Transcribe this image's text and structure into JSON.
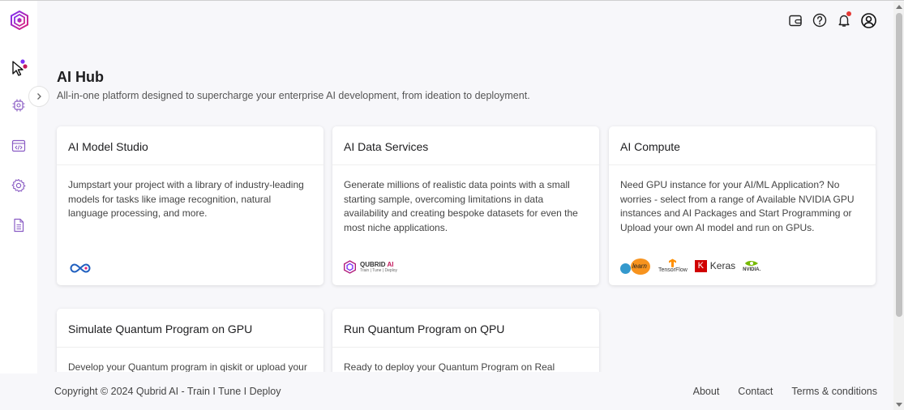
{
  "page": {
    "title": "AI Hub",
    "subtitle": "All-in-one platform designed to supercharge your enterprise AI development, from ideation to deployment."
  },
  "cards": [
    {
      "title": "AI Model Studio",
      "description": "Jumpstart your project with a library of industry-leading models for tasks like image recognition, natural language processing, and more."
    },
    {
      "title": "AI Data Services",
      "description": "Generate millions of realistic data points with a small starting sample, overcoming limitations in data availability and creating bespoke datasets for even the most niche applications.",
      "logo_text": "QUBRID",
      "logo_ai": "AI",
      "logo_tagline": "Train | Tune | Deploy"
    },
    {
      "title": "AI Compute",
      "description": "Need GPU instance for your AI/ML Application? No worries - select from a range of Available NVIDIA GPU instances and AI Packages and Start Programming or Upload your own AI model and run on GPUs.",
      "tech_logos": [
        "learn",
        "TensorFlow",
        "Keras",
        "NVIDIA."
      ]
    },
    {
      "title": "Simulate Quantum Program on GPU",
      "description": "Develop your Quantum program in qiskit or upload your"
    },
    {
      "title": "Run Quantum Program on QPU",
      "description": "Ready to deploy your Quantum Program on Real"
    }
  ],
  "footer": {
    "copyright": "Copyright © 2024 Qubrid AI - Train I Tune I Deploy",
    "links": [
      "About",
      "Contact",
      "Terms & conditions"
    ]
  },
  "icons": {
    "brand": "qubrid-hex-logo",
    "nav": [
      "pointer-hub-icon",
      "chip-icon",
      "code-window-icon",
      "gear-icon",
      "document-icon"
    ],
    "topbar": [
      "wallet-icon",
      "help-icon",
      "bell-icon",
      "user-avatar-icon"
    ]
  },
  "colors": {
    "brand_pink": "#c2185b",
    "brand_purple": "#7b2ff7",
    "background": "#f7f7fa",
    "card": "#ffffff",
    "notification": "#e53935"
  }
}
